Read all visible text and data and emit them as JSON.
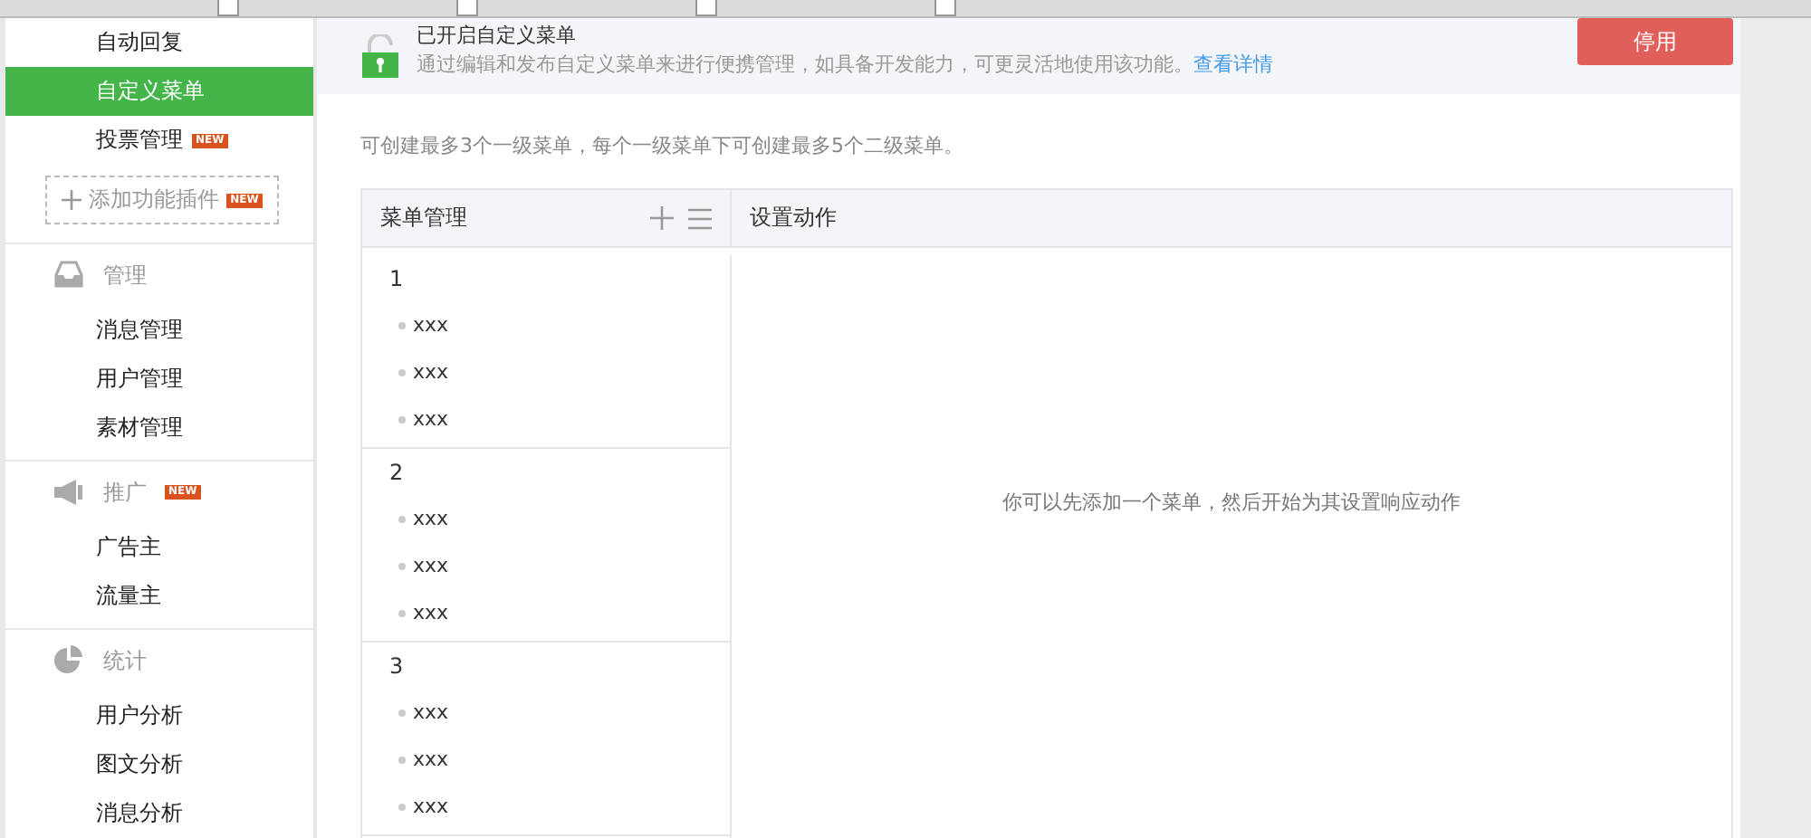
{
  "sidebar": {
    "items": [
      {
        "kind": "item",
        "label": "自动回复",
        "selected": false
      },
      {
        "kind": "item",
        "label": "自定义菜单",
        "selected": true
      },
      {
        "kind": "item",
        "label": "投票管理",
        "badge": "NEW",
        "selected": false
      },
      {
        "kind": "plugin",
        "label": "添加功能插件",
        "badge": "NEW"
      },
      {
        "kind": "section",
        "label": "管理"
      },
      {
        "kind": "item",
        "label": "消息管理",
        "selected": false
      },
      {
        "kind": "item",
        "label": "用户管理",
        "selected": false
      },
      {
        "kind": "item",
        "label": "素材管理",
        "selected": false
      },
      {
        "kind": "section",
        "label": "推广",
        "badge": "NEW"
      },
      {
        "kind": "item",
        "label": "广告主",
        "selected": false
      },
      {
        "kind": "item",
        "label": "流量主",
        "selected": false
      },
      {
        "kind": "section",
        "label": "统计"
      },
      {
        "kind": "item",
        "label": "用户分析",
        "selected": false
      },
      {
        "kind": "item",
        "label": "图文分析",
        "selected": false
      },
      {
        "kind": "item",
        "label": "消息分析",
        "selected": false
      }
    ]
  },
  "banner": {
    "title": "已开启自定义菜单",
    "description": "通过编辑和发布自定义菜单来进行便携管理，如具备开发能力，可更灵活地使用该功能。",
    "link": "查看详情",
    "button": "停用"
  },
  "note": "可创建最多3个一级菜单，每个一级菜单下可创建最多5个二级菜单。",
  "editor": {
    "menu_header": "菜单管理",
    "action_header": "设置动作",
    "empty_hint": "你可以先添加一个菜单，然后开始为其设置响应动作",
    "menus": [
      {
        "label": "1",
        "children": [
          {
            "label": "xxx"
          },
          {
            "label": "xxx"
          },
          {
            "label": "xxx"
          }
        ]
      },
      {
        "label": "2",
        "children": [
          {
            "label": "xxx"
          },
          {
            "label": "xxx"
          },
          {
            "label": "xxx"
          }
        ]
      },
      {
        "label": "3",
        "children": [
          {
            "label": "xxx"
          },
          {
            "label": "xxx"
          },
          {
            "label": "xxx"
          }
        ]
      }
    ]
  }
}
